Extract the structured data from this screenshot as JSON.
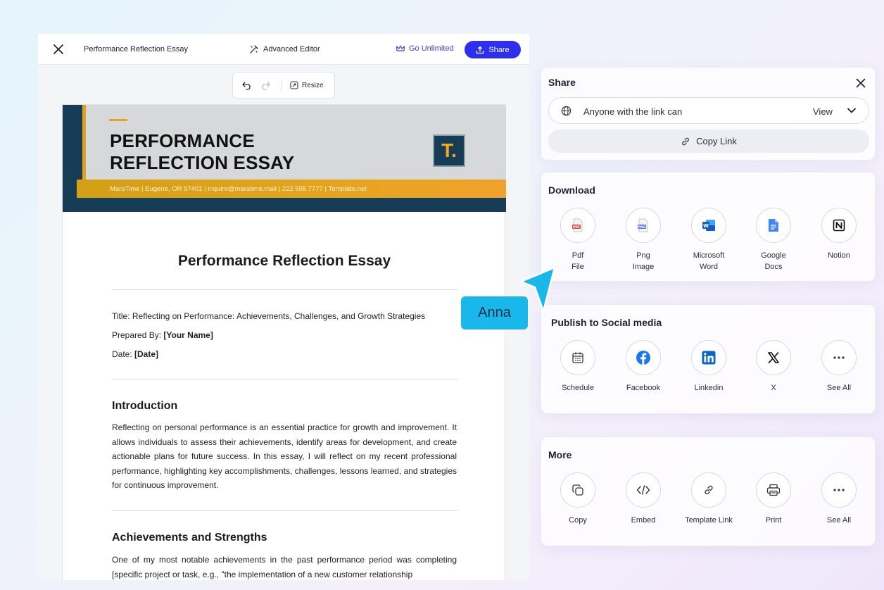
{
  "colors": {
    "primary": "#2d2ef0",
    "cyan": "#1ab8ea",
    "navy": "#163d55",
    "gold": "#e6a41e"
  },
  "editor": {
    "doc_title": "Performance Reflection Essay",
    "advanced_editor": "Advanced Editor",
    "go_unlimited": "Go Unlimited",
    "share": "Share",
    "resize": "Resize"
  },
  "document": {
    "header_title_line1": "PERFORMANCE",
    "header_title_line2": "REFLECTION ESSAY",
    "header_contact": "MaraTime | Eugene, OR 97401 | inquire@maratime.mail | 222 555 7777 | Template.net",
    "logo_letter": "T.",
    "heading": "Performance Reflection Essay",
    "title_line": "Title: Reflecting on Performance: Achievements, Challenges, and Growth Strategies",
    "prepared_label": "Prepared By: ",
    "prepared_value": "[Your Name]",
    "date_label": "Date: ",
    "date_value": "[Date]",
    "intro_heading": "Introduction",
    "intro_text": "Reflecting on personal performance is an essential practice for growth and improvement. It allows individuals to assess their achievements, identify areas for development, and create actionable plans for future success. In this essay, I will reflect on my recent professional performance, highlighting key accomplishments, challenges, lessons learned, and strategies for continuous improvement.",
    "achievements_heading": "Achievements and Strengths",
    "achievements_text": "One of my most notable achievements in the past performance period was completing [specific project or task, e.g., \"the implementation of a new customer relationship"
  },
  "share_panel": {
    "title": "Share",
    "link_access": "Anyone with the link can",
    "permission": "View",
    "copy_link": "Copy Link"
  },
  "download": {
    "title": "Download",
    "items": [
      {
        "line1": "Pdf",
        "line2": "File",
        "icon": "pdf-icon"
      },
      {
        "line1": "Png",
        "line2": "Image",
        "icon": "png-icon"
      },
      {
        "line1": "Microsoft",
        "line2": "Word",
        "icon": "word-icon"
      },
      {
        "line1": "Google",
        "line2": "Docs",
        "icon": "google-docs-icon"
      },
      {
        "line1": "Notion",
        "line2": "",
        "icon": "notion-icon"
      }
    ]
  },
  "social": {
    "title": "Publish to Social media",
    "items": [
      {
        "label": "Schedule",
        "icon": "calendar-icon"
      },
      {
        "label": "Facebook",
        "icon": "facebook-icon"
      },
      {
        "label": "Linkedin",
        "icon": "linkedin-icon"
      },
      {
        "label": "X",
        "icon": "x-icon"
      },
      {
        "label": "See All",
        "icon": "more-icon"
      }
    ]
  },
  "more": {
    "title": "More",
    "items": [
      {
        "label": "Copy",
        "icon": "copy-icon"
      },
      {
        "label": "Embed",
        "icon": "embed-icon"
      },
      {
        "label": "Template Link",
        "icon": "link-icon"
      },
      {
        "label": "Print",
        "icon": "print-icon"
      },
      {
        "label": "See All",
        "icon": "more-icon"
      }
    ]
  },
  "cursor": {
    "name": "Anna"
  }
}
